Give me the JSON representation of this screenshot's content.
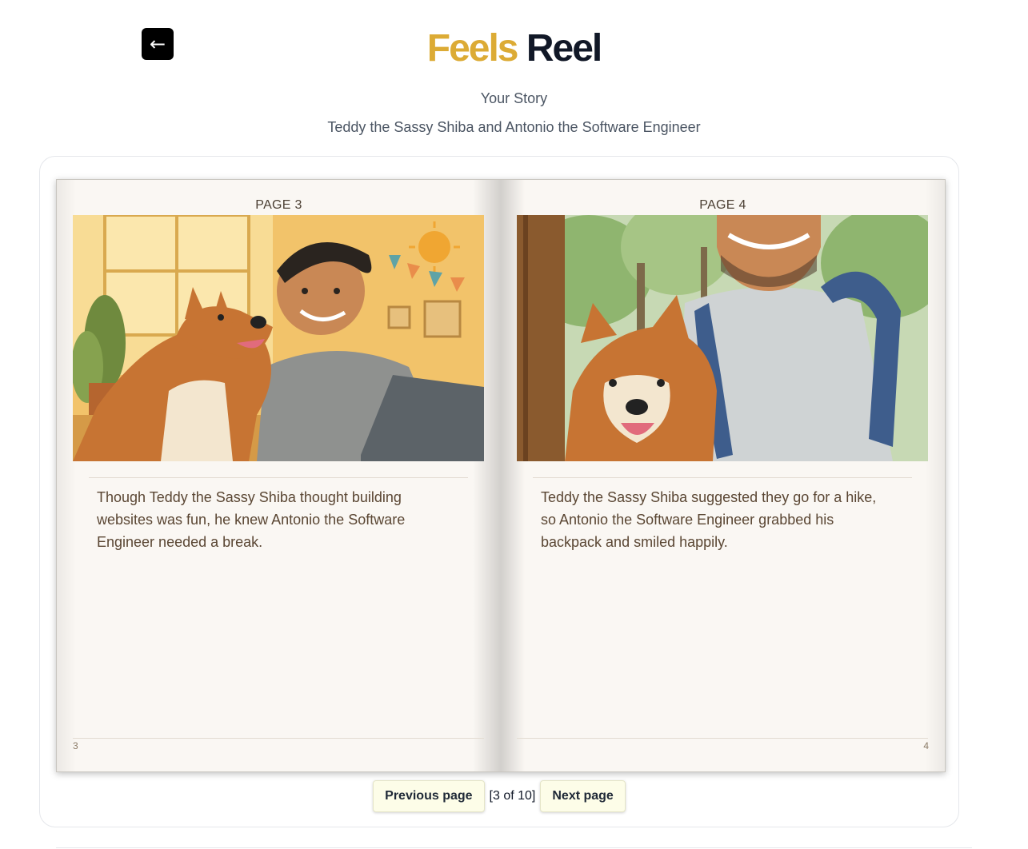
{
  "header": {
    "back_glyph": "←",
    "brand_first": "Feels",
    "brand_second": "Reel",
    "subtitle": "Your Story",
    "story_title": "Teddy the Sassy Shiba and Antonio the Software Engineer"
  },
  "book": {
    "left_page": {
      "label": "PAGE 3",
      "text": "Though Teddy the Sassy Shiba thought building websites was fun, he knew Antonio the Software Engineer needed a break.",
      "number": "3"
    },
    "right_page": {
      "label": "PAGE 4",
      "text": "Teddy the Sassy Shiba suggested they go for a hike, so Antonio the Software Engineer grabbed his backpack and smiled happily.",
      "number": "4"
    }
  },
  "pager": {
    "prev_label": "Previous page",
    "count_label": "[3 of 10]",
    "next_label": "Next page"
  },
  "colors": {
    "brand_accent": "#dcab35",
    "brand_dark": "#111827",
    "button_bg": "#fdfde8",
    "paper": "#faf7f3"
  },
  "icons": {
    "back": "arrow-left-icon"
  }
}
